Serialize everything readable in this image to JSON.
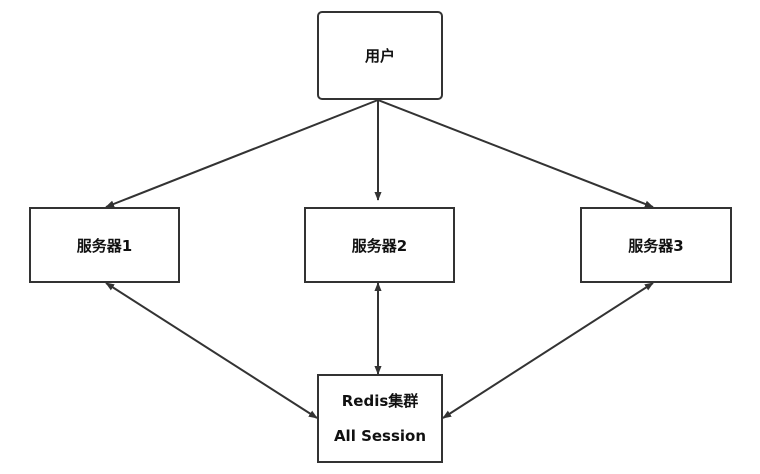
{
  "diagram": {
    "nodes": {
      "user": {
        "label": "用户"
      },
      "server1": {
        "label": "服务器1"
      },
      "server2": {
        "label": "服务器2"
      },
      "server3": {
        "label": "服务器3"
      },
      "redis": {
        "line1": "Redis集群",
        "line2": "All Session"
      }
    },
    "edges": [
      {
        "from": "user",
        "to": "server1",
        "direction": "forward"
      },
      {
        "from": "user",
        "to": "server2",
        "direction": "forward"
      },
      {
        "from": "user",
        "to": "server3",
        "direction": "forward"
      },
      {
        "from": "server1",
        "to": "redis",
        "direction": "both"
      },
      {
        "from": "server2",
        "to": "redis",
        "direction": "both"
      },
      {
        "from": "server3",
        "to": "redis",
        "direction": "both"
      }
    ],
    "colors": {
      "stroke": "#333333",
      "text": "#111111",
      "background": "#ffffff"
    }
  }
}
